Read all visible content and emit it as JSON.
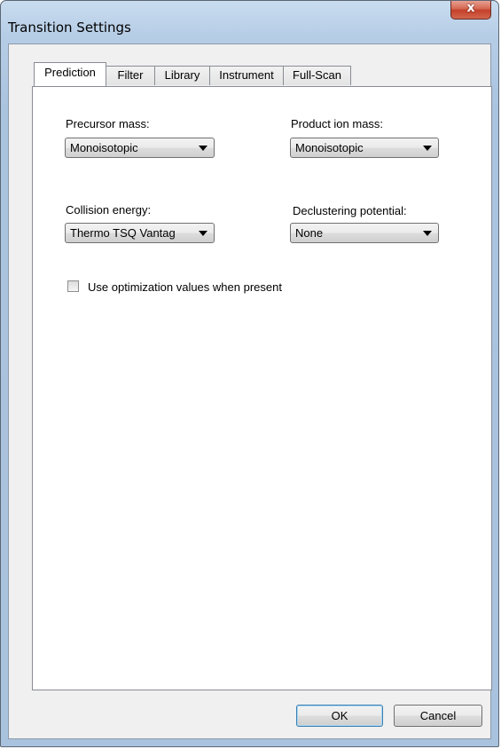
{
  "window": {
    "title": "Transition Settings",
    "close_glyph": "x"
  },
  "tabs": [
    {
      "label": "Prediction",
      "active": true
    },
    {
      "label": "Filter",
      "active": false
    },
    {
      "label": "Library",
      "active": false
    },
    {
      "label": "Instrument",
      "active": false
    },
    {
      "label": "Full-Scan",
      "active": false
    }
  ],
  "prediction": {
    "precursor_mass": {
      "label": "Precursor mass:",
      "value": "Monoisotopic"
    },
    "product_ion_mass": {
      "label": "Product ion mass:",
      "value": "Monoisotopic"
    },
    "collision_energy": {
      "label": "Collision energy:",
      "value": "Thermo TSQ Vantag"
    },
    "declustering_potential": {
      "label": "Declustering potential:",
      "value": "None"
    },
    "use_optimization": {
      "label": "Use optimization values when present",
      "checked": false
    }
  },
  "buttons": {
    "ok": "OK",
    "cancel": "Cancel"
  }
}
